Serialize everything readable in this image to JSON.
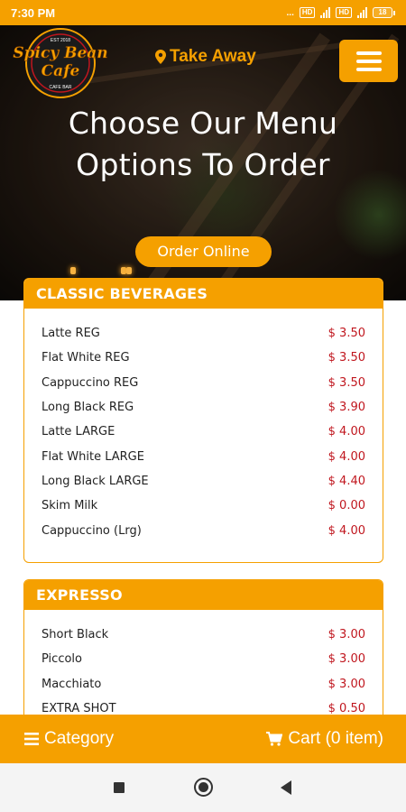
{
  "status_bar": {
    "time": "7:30 PM",
    "dots": "...",
    "network1": "HD",
    "network2": "HD",
    "battery": "18"
  },
  "header": {
    "logo_text": "Spicy Bean Cafe",
    "logo_est": "EST 2018",
    "logo_sub": "CAFE BAR",
    "take_away_label": "Take Away",
    "menu_icon": "hamburger-icon"
  },
  "hero": {
    "title_line1": "Choose Our Menu",
    "title_line2": "Options To Order",
    "order_button": "Order Online"
  },
  "menu": {
    "sections": [
      {
        "title": "CLASSIC BEVERAGES",
        "items": [
          {
            "name": "Latte REG",
            "price": "$ 3.50"
          },
          {
            "name": "Flat White REG",
            "price": "$ 3.50"
          },
          {
            "name": "Cappuccino REG",
            "price": "$ 3.50"
          },
          {
            "name": "Long Black REG",
            "price": "$ 3.90"
          },
          {
            "name": "Latte LARGE",
            "price": "$ 4.00"
          },
          {
            "name": "Flat White LARGE",
            "price": "$ 4.00"
          },
          {
            "name": "Long Black LARGE",
            "price": "$ 4.40"
          },
          {
            "name": "Skim Milk",
            "price": "$ 0.00"
          },
          {
            "name": "Cappuccino (Lrg)",
            "price": "$ 4.00"
          }
        ]
      },
      {
        "title": "EXPRESSO",
        "items": [
          {
            "name": "Short Black",
            "price": "$ 3.00"
          },
          {
            "name": "Piccolo",
            "price": "$ 3.00"
          },
          {
            "name": "Macchiato",
            "price": "$ 3.00"
          },
          {
            "name": "EXTRA SHOT",
            "price": "$ 0.50"
          }
        ]
      }
    ]
  },
  "bottom_bar": {
    "category_label": "Category",
    "cart_label": "Cart (0 item)"
  },
  "colors": {
    "accent": "#f5a000",
    "price": "#c0161e",
    "text": "#222222"
  }
}
